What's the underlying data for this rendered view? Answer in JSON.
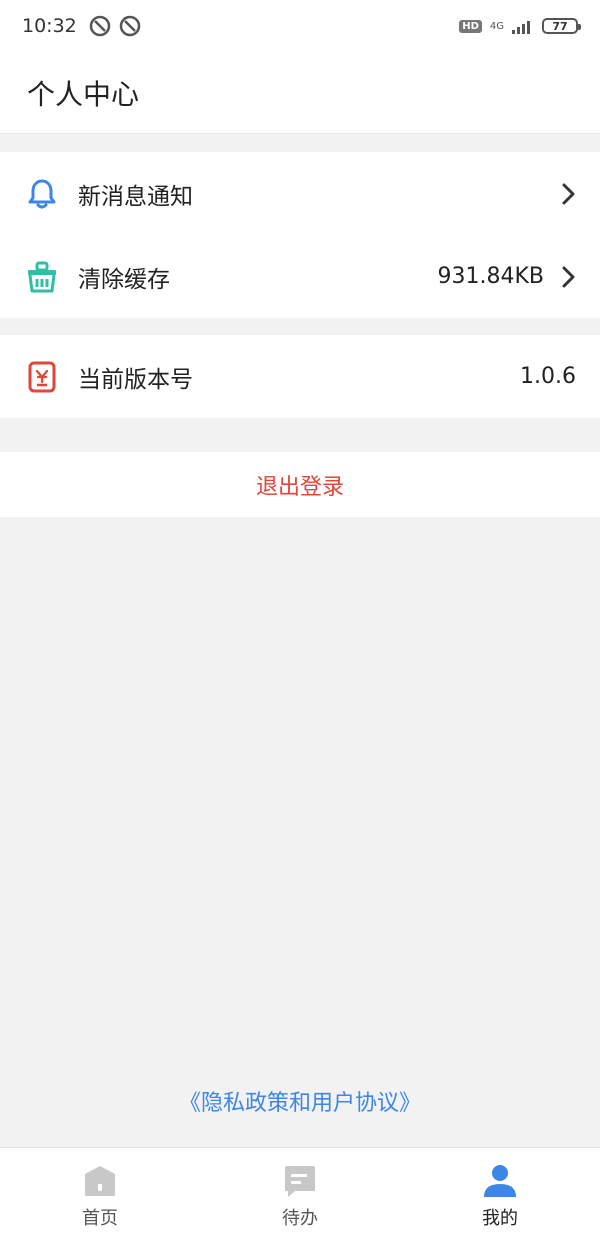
{
  "status_bar": {
    "time": "10:32",
    "network": "4G",
    "hd": "HD",
    "battery": "77"
  },
  "header": {
    "title": "个人中心"
  },
  "settings": {
    "notifications": {
      "label": "新消息通知",
      "icon": "bell-icon"
    },
    "clear_cache": {
      "label": "清除缓存",
      "value": "931.84KB",
      "icon": "basket-icon"
    },
    "version": {
      "label": "当前版本号",
      "value": "1.0.6",
      "icon": "version-icon"
    }
  },
  "logout": {
    "label": "退出登录"
  },
  "policy": {
    "label": "《隐私政策和用户协议》"
  },
  "tabbar": {
    "items": [
      {
        "label": "首页",
        "icon": "home-icon"
      },
      {
        "label": "待办",
        "icon": "todo-icon"
      },
      {
        "label": "我的",
        "icon": "user-icon"
      }
    ]
  },
  "colors": {
    "accent_blue": "#3d86e6",
    "logout_red": "#e0463a",
    "cache_green": "#2ebfa5",
    "version_red": "#e0463a"
  }
}
